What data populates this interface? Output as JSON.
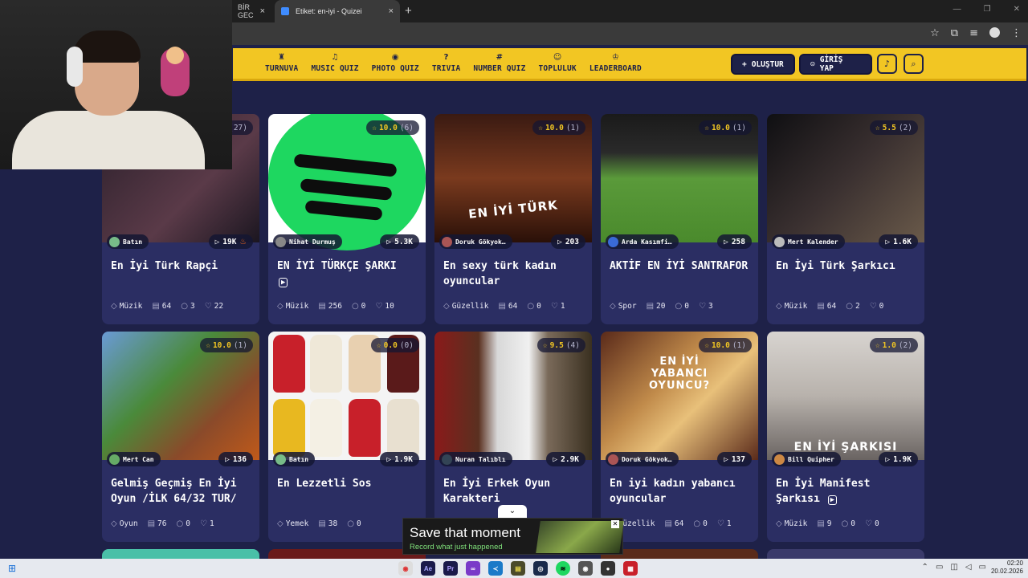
{
  "browser": {
    "tab_inactive_label": "BİR GEC",
    "tab_active_label": "Etiket: en-iyi - Quizei",
    "new_tab": "+",
    "close": "×",
    "window_controls": [
      "—",
      "❐",
      "✕"
    ]
  },
  "site": {
    "nav": [
      {
        "label": "TURNUVA",
        "icon": "trophy-icon"
      },
      {
        "label": "MUSIC QUIZ",
        "icon": "music-icon"
      },
      {
        "label": "PHOTO QUIZ",
        "icon": "camera-icon"
      },
      {
        "label": "TRIVIA",
        "icon": "question-icon"
      },
      {
        "label": "NUMBER QUIZ",
        "icon": "hash-icon"
      },
      {
        "label": "TOPLULUK",
        "icon": "users-icon"
      },
      {
        "label": "LEADERBOARD",
        "icon": "crown-icon"
      }
    ],
    "create_label": "OLUŞTUR",
    "login_label": "GİRİŞ YAP"
  },
  "partial_card": {
    "rating_count": "(27)",
    "author": "Batın",
    "plays": "19K",
    "title": "En İyi Türk Rapçi",
    "category": "Müzik",
    "questions": "64",
    "comments": "3",
    "likes": "22"
  },
  "cards": [
    {
      "rating": "10.0",
      "rating_count": "(6)",
      "author": "Nihat Durmuş",
      "plays": "5.3K",
      "title": "EN İYİ TÜRKÇE ŞARKI",
      "category": "Müzik",
      "questions": "256",
      "comments": "0",
      "likes": "10"
    },
    {
      "rating": "10.0",
      "rating_count": "(1)",
      "author": "Doruk Gökyok…",
      "plays": "203",
      "title": "En sexy türk kadın oyuncular",
      "category": "Güzellik",
      "questions": "64",
      "comments": "0",
      "likes": "1",
      "img_text": "EN İYİ TÜRK"
    },
    {
      "rating": "10.0",
      "rating_count": "(1)",
      "author": "Arda Kasımfi…",
      "plays": "258",
      "title": "AKTİF EN İYİ SANTRAFOR",
      "category": "Spor",
      "questions": "20",
      "comments": "0",
      "likes": "3"
    },
    {
      "rating": "5.5",
      "rating_count": "(2)",
      "author": "Mert Kalender",
      "plays": "1.6K",
      "title": "En İyi Türk Şarkıcı",
      "category": "Müzik",
      "questions": "64",
      "comments": "2",
      "likes": "0"
    },
    {
      "rating": "10.0",
      "rating_count": "(1)",
      "author": "Mert Can",
      "plays": "136",
      "title": "Gelmiş Geçmiş En İyi Oyun /İLK 64/32 TUR/",
      "category": "Oyun",
      "questions": "76",
      "comments": "0",
      "likes": "1"
    },
    {
      "rating": "0.0",
      "rating_count": "(0)",
      "author": "Batın",
      "plays": "1.9K",
      "title": "En Lezzetli Sos",
      "category": "Yemek",
      "questions": "38",
      "comments": "0",
      "likes": ""
    },
    {
      "rating": "9.5",
      "rating_count": "(4)",
      "author": "Nuran Talıblı",
      "plays": "2.9K",
      "title": "En İyi Erkek Oyun Karakteri",
      "category": "",
      "questions": "",
      "comments": "",
      "likes": ""
    },
    {
      "rating": "10.0",
      "rating_count": "(1)",
      "author": "Doruk Gökyok…",
      "plays": "137",
      "title": "En iyi kadın yabancı oyuncular",
      "category": "Güzellik",
      "questions": "64",
      "comments": "0",
      "likes": "1",
      "img_text": "EN İYİ YABANCI OYUNCU?"
    },
    {
      "rating": "1.0",
      "rating_count": "(2)",
      "author": "Bill Quipher",
      "plays": "1.9K",
      "title": "En İyi Manifest Şarkısı",
      "category": "Müzik",
      "questions": "9",
      "comments": "0",
      "likes": "0",
      "img_text": "EN İYİ ŞARKISI"
    }
  ],
  "popup": {
    "title": "Save that moment",
    "subtitle": "Record what just happened"
  },
  "taskbar": {
    "time": "02:20",
    "date": "20.02.2026"
  },
  "colors": {
    "header_yellow": "#f2c623",
    "bg_navy": "#1e2148",
    "card_bg": "#2b2e63"
  }
}
